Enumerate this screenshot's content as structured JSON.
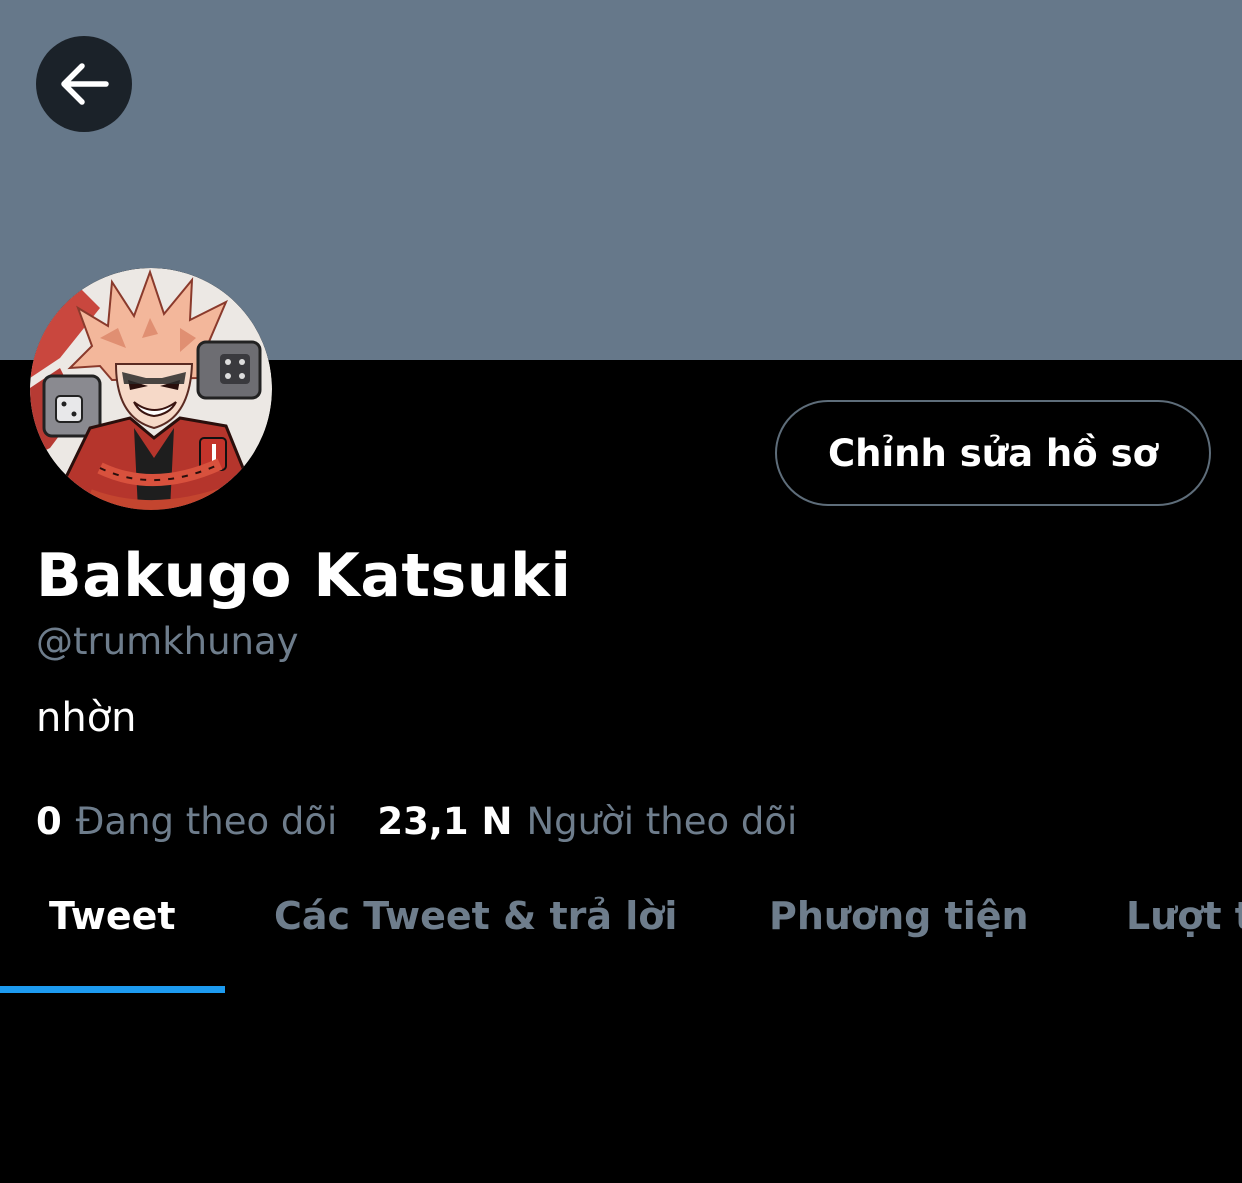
{
  "profile": {
    "display_name": "Bakugo Katsuki",
    "handle": "@trumkhunay",
    "bio": "nhờn",
    "edit_button_label": "Chỉnh sửa hồ sơ",
    "avatar_icon": "anime-avatar"
  },
  "stats": {
    "following_count": "0",
    "following_label": "Đang theo dõi",
    "followers_count": "23,1 N",
    "followers_label": "Người theo dõi"
  },
  "tabs": [
    {
      "label": "Tweet",
      "active": true
    },
    {
      "label": "Các Tweet & trả lời",
      "active": false
    },
    {
      "label": "Phương tiện",
      "active": false
    },
    {
      "label": "Lượt thích",
      "active": false
    }
  ],
  "icons": {
    "back": "arrow-left-icon"
  },
  "colors": {
    "banner": "#66788a",
    "background": "#000000",
    "accent": "#1d9bf0",
    "secondary_text": "#6e7d8c"
  }
}
